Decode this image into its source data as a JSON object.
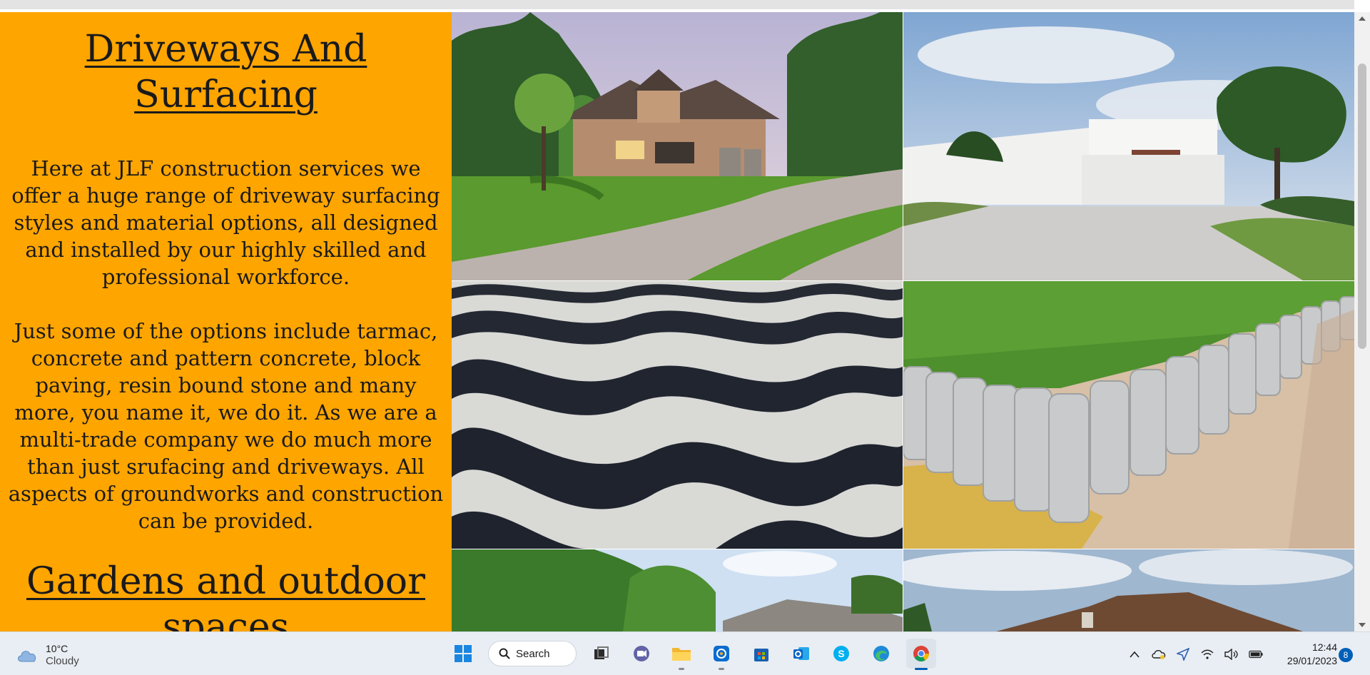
{
  "page": {
    "section1_heading": "Driveways And Surfacing",
    "section1_paragraph1": "Here at JLF construction services we offer a huge range of driveway surfacing styles and material options, all designed and installed by our highly skilled and professional workforce.",
    "section1_paragraph2": "Just some of the options include tarmac, concrete and pattern concrete, block paving, resin bound stone and many more, you name it, we do it. As we are a multi-trade company we do much more than just srufacing and driveways. All aspects of groundworks and construction can be provided.",
    "section2_heading": "Gardens and outdoor spaces"
  },
  "colors": {
    "sidebar_bg": "#ffa500",
    "taskbar_bg": "#e9eef4",
    "accent": "#005fb8"
  },
  "taskbar": {
    "weather": {
      "temp": "10°C",
      "condition": "Cloudy",
      "icon": "cloud-icon"
    },
    "search_label": "Search",
    "apps": [
      {
        "name": "start",
        "icon": "windows-start-icon"
      },
      {
        "name": "task-view",
        "icon": "task-view-icon"
      },
      {
        "name": "chat",
        "icon": "teams-chat-icon"
      },
      {
        "name": "file-explorer",
        "icon": "folder-icon"
      },
      {
        "name": "snipping",
        "icon": "snipping-tool-icon"
      },
      {
        "name": "store",
        "icon": "store-icon"
      },
      {
        "name": "outlook",
        "icon": "outlook-icon"
      },
      {
        "name": "skype",
        "icon": "skype-icon"
      },
      {
        "name": "edge",
        "icon": "edge-icon"
      },
      {
        "name": "chrome",
        "icon": "chrome-icon"
      }
    ],
    "tray": {
      "icons": [
        "chevron-up-icon",
        "onedrive-icon",
        "location-icon",
        "wifi-icon",
        "volume-icon",
        "battery-icon"
      ]
    },
    "time": "12:44",
    "date": "29/01/2023",
    "notification_count": "8"
  }
}
